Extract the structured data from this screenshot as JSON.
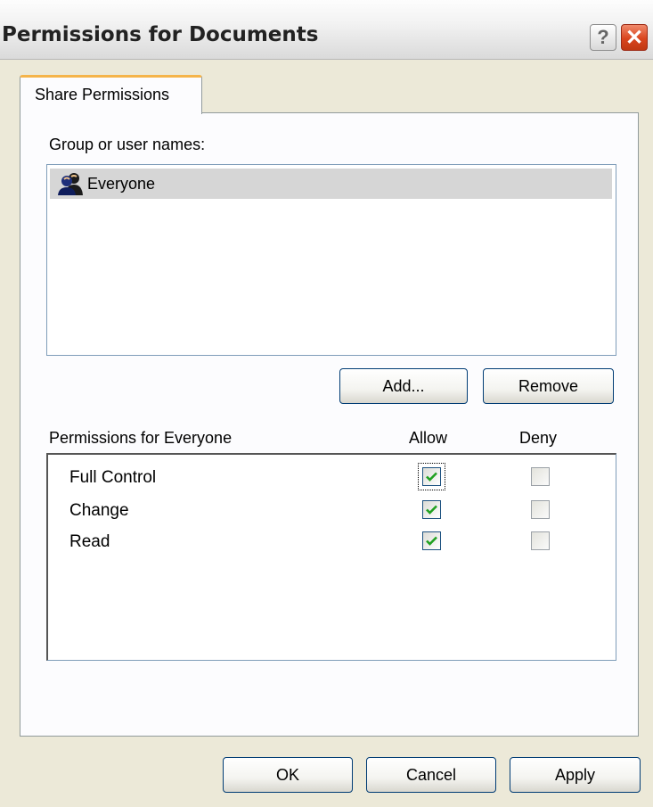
{
  "window": {
    "title": "Permissions for Documents",
    "help_icon": "question-mark",
    "close_icon": "x",
    "accent_tab_color": "#f5b44a",
    "close_color": "#d9451e"
  },
  "tabs": [
    {
      "label": "Share Permissions",
      "active": true
    }
  ],
  "group_section": {
    "label": "Group or user names:",
    "items": [
      {
        "name": "Everyone",
        "icon": "users-group-icon",
        "selected": true
      }
    ],
    "add_button": "Add...",
    "remove_button": "Remove"
  },
  "permissions": {
    "label": "Permissions for Everyone",
    "allow_header": "Allow",
    "deny_header": "Deny",
    "rows": [
      {
        "name": "Full Control",
        "allow": true,
        "deny": false
      },
      {
        "name": "Change",
        "allow": true,
        "deny": false
      },
      {
        "name": "Read",
        "allow": true,
        "deny": false
      }
    ]
  },
  "footer": {
    "ok": "OK",
    "cancel": "Cancel",
    "apply": "Apply"
  }
}
